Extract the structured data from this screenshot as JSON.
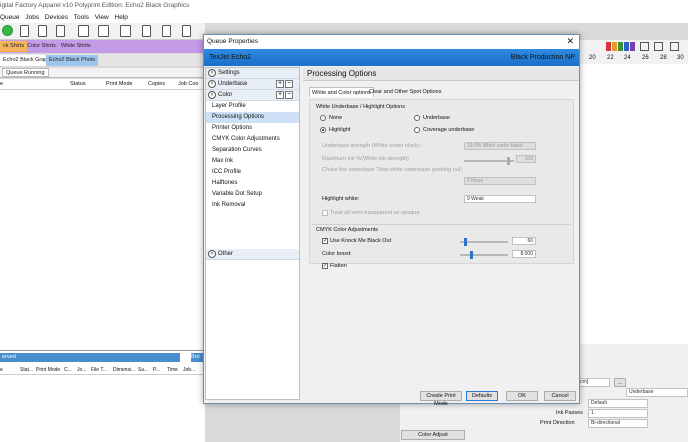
{
  "app": {
    "title": "igital Factory Apparel v10 Polyprint Edition: Echo2 Black Graphics",
    "menu": [
      "Queue",
      "Jobs",
      "Devices",
      "Tools",
      "View",
      "Help"
    ]
  },
  "main": {
    "tabs": [
      "ck Shirts",
      "Color Shirts",
      "White Shirts"
    ],
    "subtabs": [
      "Echo2 Black Graphics",
      "Echo2 Black Photo"
    ],
    "queue_tab": "Queue Running",
    "columns": [
      "e",
      "Status",
      "Print Mode",
      "Copies",
      "Job Coo"
    ],
    "bottom_tab": "erved",
    "bottom_tab_right": "Bro",
    "bottom_columns": [
      "e",
      "Stat...",
      "Print Mode",
      "C...",
      "Jo...",
      "File T...",
      "Dimensi...",
      "Su...",
      "P...",
      "Time",
      "Job..."
    ]
  },
  "right_ruler": [
    "20",
    "22",
    "24",
    "26",
    "28",
    "30"
  ],
  "bottom_right": {
    "size_value": "2.00 cm]",
    "size_button": "...",
    "underbase_value": "Underbase",
    "ink_label": "Ink",
    "ink_value": "Default",
    "ink_passes_label": "Ink Passes",
    "ink_passes_value": "1",
    "print_direction_label": "Print Direction",
    "print_direction_value": "Bi-directional",
    "color_adjust": "Color Adjust"
  },
  "dialog": {
    "title": "Queue Properties",
    "close": "✕",
    "device": "TexJet Echo2",
    "profile": "Black Production NP",
    "nav": {
      "settings": "Settings",
      "underbase": "Underbase",
      "color": "Color",
      "other": "Other",
      "color_items": [
        "Layer Profile",
        "Processing Options",
        "Printer Options",
        "CMYK Color Adjustments",
        "Separation Curves",
        "Max Ink",
        "ICC Profile",
        "Halftones",
        "Variable Dot Setup",
        "Ink Removal"
      ]
    },
    "content": {
      "heading": "Processing Options",
      "tabs": [
        "White and Color options",
        "Clear and Other Spot Options"
      ],
      "white_group_title": "White Underbase / Highlight Options",
      "radio_none": "None",
      "radio_underbase": "Underbase",
      "radio_highlight": "Highlight",
      "radio_coverage": "Coverage underbase",
      "underbase_strength_label": "Underbase strength (White under black):",
      "underbase_strength_value": "19 0% White under black",
      "max_ink_label": "Maximum Ink %(White ink strength)",
      "max_ink_value": "100",
      "choke_label": "Choke the underbase 'Stop white underbase peeking out':",
      "choke_value": "0 None",
      "highlight_white_label": "Highlight white:",
      "highlight_white_value": "9 Weak",
      "treat_semi_label": "Treat all semi transparent as opaque.",
      "cmyk_group_title": "CMYK Color Adjustments",
      "knock_me_label": "Use Knock Me Black Out",
      "knock_me_value": "60",
      "color_boost_label": "Color boost:",
      "color_boost_value": "8.000",
      "flatten_label": "Flatten"
    },
    "buttons": {
      "create_print_mode": "Create Print Mode",
      "defaults": "Defaults",
      "ok": "OK",
      "cancel": "Cancel"
    }
  }
}
